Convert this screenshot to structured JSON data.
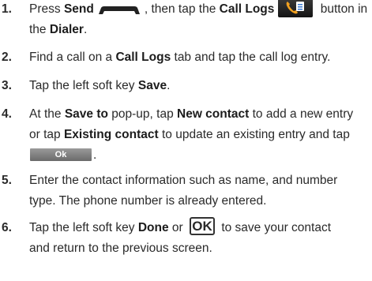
{
  "steps": [
    {
      "number": "1.",
      "parts": [
        "Press ",
        "Send",
        ", then tap the ",
        "Call Logs",
        " button in",
        "the ",
        "Dialer",
        "."
      ]
    },
    {
      "number": "2.",
      "parts": [
        "Find a call on a ",
        "Call Logs",
        " tab and tap the call log entry."
      ]
    },
    {
      "number": "3.",
      "parts": [
        "Tap the left soft key ",
        "Save",
        "."
      ]
    },
    {
      "number": "4.",
      "parts": [
        "At the ",
        "Save to",
        " pop-up, tap ",
        "New contact",
        " to add a new entry",
        "or tap ",
        "Existing contact",
        " to update an existing entry and tap",
        "."
      ],
      "ok_button_label": "Ok"
    },
    {
      "number": "5.",
      "parts": [
        "Enter the contact information such as name, and number",
        "type. The phone number is already entered."
      ]
    },
    {
      "number": "6.",
      "parts": [
        "Tap the left soft key ",
        "Done",
        " or ",
        " to save your  contact",
        "and return to the previous screen."
      ],
      "ok_key_label": "OK"
    }
  ],
  "icons": {
    "send_key": "send-key-icon",
    "call_logs_button": "call-logs-icon",
    "ok_hardware_key": "ok-key-icon"
  },
  "colors": {
    "text": "#2a2a2a",
    "button_dark": "#1c1c1c",
    "ok_button_gray": "#8a8a8a",
    "call_logs_phone": "#f0a020",
    "call_logs_list": "#3a7bd5"
  }
}
